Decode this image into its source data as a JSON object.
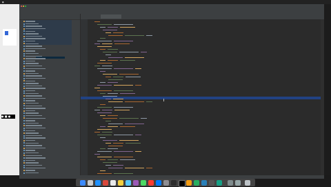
{
  "menubar": {
    "items": [
      "",
      "",
      "",
      "",
      "",
      "",
      "",
      "",
      "",
      "",
      ""
    ],
    "title": "",
    "clock": ""
  },
  "editor": {
    "tabs": [
      "",
      ""
    ]
  },
  "colors": {
    "ide_bg": "#2b2b2b",
    "panel_bg": "#3c3f41",
    "highlight_line": "#214283",
    "keyword": "#cc7832",
    "string": "#6a8759",
    "text": "#a9b7c6"
  }
}
